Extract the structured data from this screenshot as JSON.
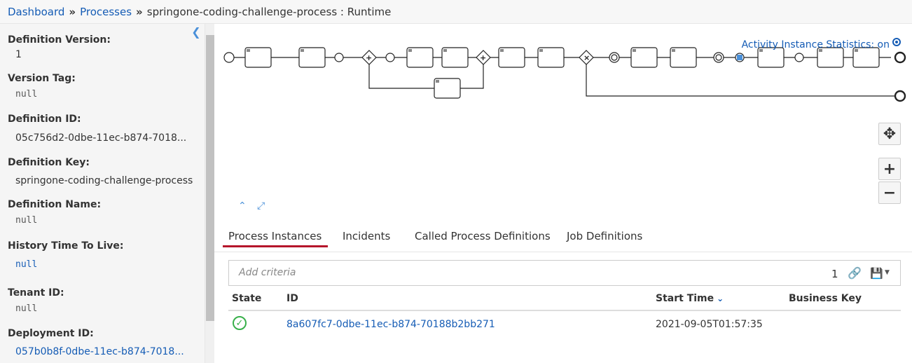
{
  "breadcrumb": {
    "dashboard": "Dashboard",
    "processes": "Processes",
    "separator": "»",
    "current": "springone-coding-challenge-process : Runtime"
  },
  "sidebar": {
    "fields": [
      {
        "label": "Definition Version:",
        "value": "1"
      },
      {
        "label": "Version Tag:",
        "value": "null"
      },
      {
        "label": "Definition ID:",
        "value": "05c756d2-0dbe-11ec-b874-7018..."
      },
      {
        "label": "Definition Key:",
        "value": "springone-coding-challenge-process"
      },
      {
        "label": "Definition Name:",
        "value": "null"
      },
      {
        "label": "History Time To Live:",
        "value": "null"
      },
      {
        "label": "Tenant ID:",
        "value": "null"
      },
      {
        "label": "Deployment ID:",
        "value": "057b0b8f-0dbe-11ec-b874-7018..."
      }
    ]
  },
  "diagram": {
    "stats_label": "Activity Instance Statistics: on"
  },
  "tabs": [
    "Process Instances",
    "Incidents",
    "Called Process Definitions",
    "Job Definitions"
  ],
  "search": {
    "placeholder": "Add criteria",
    "count": "1"
  },
  "table": {
    "columns": [
      "State",
      "ID",
      "Start Time",
      "Business Key"
    ],
    "rows": [
      {
        "id": "8a607fc7-0dbe-11ec-b874-70188b2bb271",
        "start_time": "2021-09-05T01:57:35",
        "business_key": ""
      }
    ]
  },
  "colors": {
    "link": "#155cb5",
    "tab_underline": "#b5152b",
    "success": "#38b04a"
  }
}
